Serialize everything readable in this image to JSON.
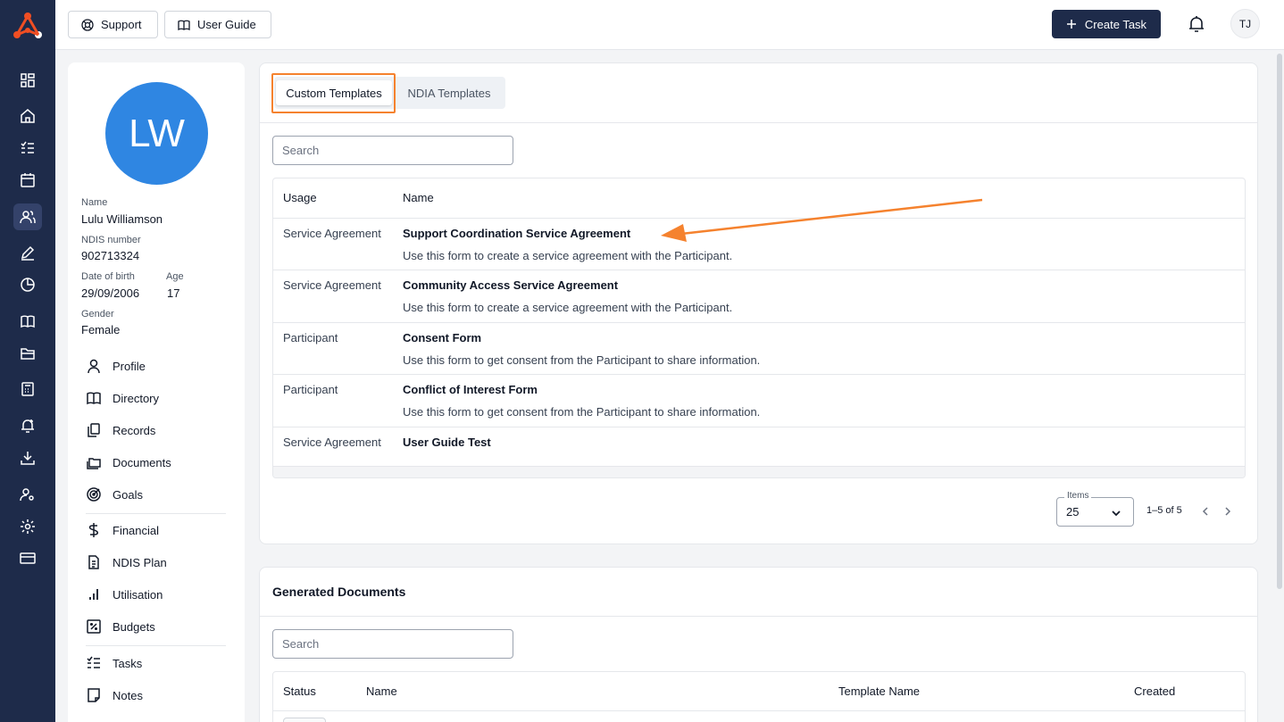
{
  "topbar": {
    "support_label": "Support",
    "user_guide_label": "User Guide",
    "create_task_label": "Create Task",
    "user_initials": "TJ"
  },
  "rail": {
    "icons": [
      "dashboard-icon",
      "home-icon",
      "checklist-icon",
      "calendar-icon",
      "people-icon",
      "pen-icon",
      "pie-chart-icon",
      "book-icon",
      "folder-icon",
      "calculator-icon",
      "bell-plus-icon",
      "download-icon",
      "user-settings-icon",
      "gear-icon",
      "card-icon"
    ],
    "active": "people-icon"
  },
  "profile": {
    "initials": "LW",
    "name_label": "Name",
    "name": "Lulu Williamson",
    "ndis_label": "NDIS number",
    "ndis": "902713324",
    "dob_label": "Date of birth",
    "dob": "29/09/2006",
    "age_label": "Age",
    "age": "17",
    "gender_label": "Gender",
    "gender": "Female",
    "nav": [
      {
        "label": "Profile",
        "icon": "person-icon"
      },
      {
        "label": "Directory",
        "icon": "book-icon"
      },
      {
        "label": "Records",
        "icon": "copy-icon"
      },
      {
        "label": "Documents",
        "icon": "folders-icon"
      },
      {
        "label": "Goals",
        "icon": "target-icon"
      },
      {
        "label": "Financial",
        "icon": "dollar-icon"
      },
      {
        "label": "NDIS Plan",
        "icon": "document-icon"
      },
      {
        "label": "Utilisation",
        "icon": "bar-chart-icon"
      },
      {
        "label": "Budgets",
        "icon": "percent-icon"
      },
      {
        "label": "Tasks",
        "icon": "checklist-icon"
      },
      {
        "label": "Notes",
        "icon": "note-icon"
      }
    ]
  },
  "templates": {
    "tabs": [
      "Custom Templates",
      "NDIA Templates"
    ],
    "active_tab": "Custom Templates",
    "search_placeholder": "Search",
    "columns": [
      "Usage",
      "Name"
    ],
    "rows": [
      {
        "usage": "Service Agreement",
        "name": "Support Coordination Service Agreement",
        "description": "Use this form to create a service agreement with the Participant."
      },
      {
        "usage": "Service Agreement",
        "name": "Community Access Service Agreement",
        "description": "Use this form to create a service agreement with the Participant."
      },
      {
        "usage": "Participant",
        "name": "Consent Form",
        "description": "Use this form to get consent from the Participant to share information."
      },
      {
        "usage": "Participant",
        "name": "Conflict of Interest Form",
        "description": "Use this form to get consent from the Participant to share information."
      },
      {
        "usage": "Service Agreement",
        "name": "User Guide Test",
        "description": ""
      }
    ],
    "items_label": "Items",
    "items_value": "25",
    "page_info": "1–5 of 5"
  },
  "generated": {
    "title": "Generated Documents",
    "search_placeholder": "Search",
    "columns": [
      "Status",
      "Name",
      "Template Name",
      "Created"
    ]
  },
  "colors": {
    "rail": "#1e2b4a",
    "accent": "#f5822e",
    "avatar": "#2f86e2"
  }
}
